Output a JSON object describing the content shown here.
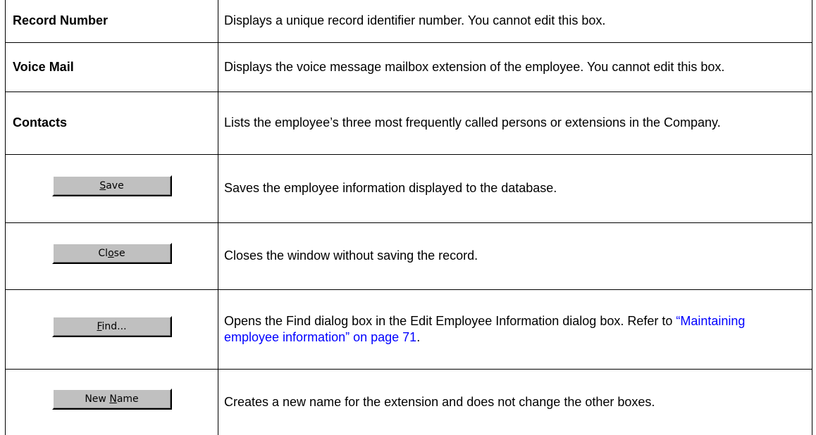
{
  "rows": [
    {
      "term": "Record Number",
      "description": "Displays a unique record identifier number. You cannot edit this box."
    },
    {
      "term": "Voice Mail",
      "description": "Displays the voice message mailbox extension of the employee. You cannot edit this box."
    },
    {
      "term": "Contacts",
      "description": "Lists the employee’s three most frequently called persons or extensions in the Company."
    }
  ],
  "buttons": [
    {
      "label_pre": "",
      "label_mnemonic": "S",
      "label_post": "ave",
      "description": "Saves the employee information displayed to the database."
    },
    {
      "label_pre": "Cl",
      "label_mnemonic": "o",
      "label_post": "se",
      "description": "Closes the window without saving the record."
    },
    {
      "label_pre": "",
      "label_mnemonic": "F",
      "label_post": "ind...",
      "description": "Opens the Find dialog box in the Edit Employee Information dialog box. Refer to ",
      "link_text": "“Maintaining employee information” on page 71",
      "description_end": "."
    },
    {
      "label_pre": "New ",
      "label_mnemonic": "N",
      "label_post": "ame",
      "description": "Creates a new name for the extension and does not change the other boxes."
    }
  ]
}
